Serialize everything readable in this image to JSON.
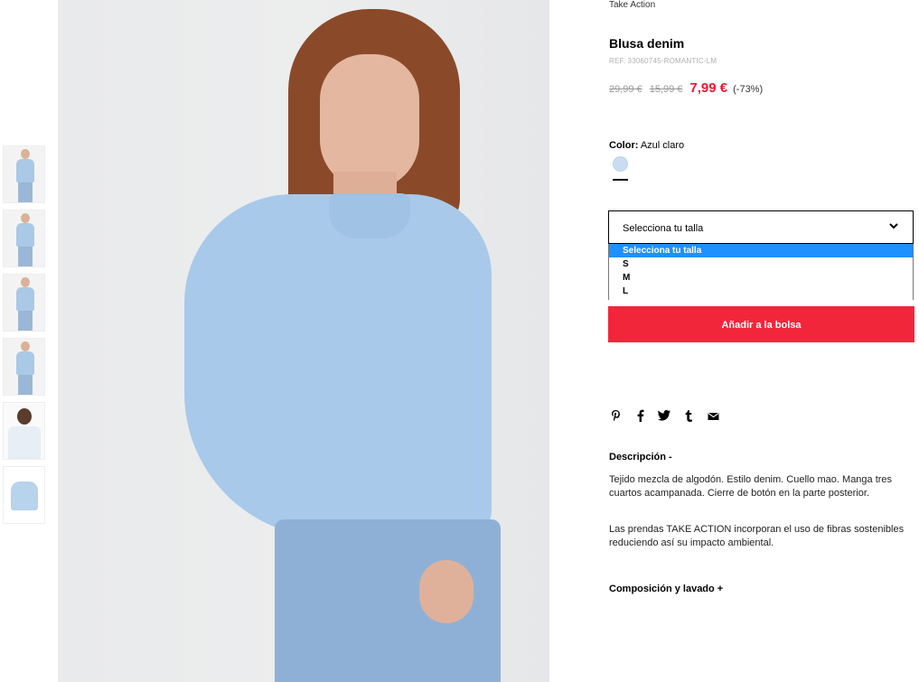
{
  "breadcrumb": "Take Action",
  "product": {
    "title": "Blusa denim",
    "ref": "REF. 33060745-ROMANTIC-LM",
    "price_original": "29,99 €",
    "price_previous": "15,99 €",
    "price_current": "7,99 €",
    "discount": "(-73%)"
  },
  "color": {
    "label": "Color:",
    "value": "Azul claro",
    "swatch_hex": "#c9dcf0"
  },
  "size_select": {
    "selected": "Selecciona tu talla",
    "options": [
      "Selecciona tu talla",
      "S",
      "M",
      "L"
    ]
  },
  "add_to_bag": "Añadir a la bolsa",
  "share_icons": [
    "pinterest-icon",
    "facebook-icon",
    "twitter-icon",
    "tumblr-icon",
    "email-icon"
  ],
  "description": {
    "heading": "Descripción -",
    "paragraph1": "Tejido mezcla de algodón. Estilo denim. Cuello mao. Manga tres cuartos acampanada. Cierre de botón en la parte posterior.",
    "paragraph2": "Las prendas TAKE ACTION incorporan el uso de fibras sostenibles reduciendo así su impacto ambiental."
  },
  "composition_heading": "Composición y lavado +",
  "colors": {
    "price_red": "#e61b2f",
    "button_red": "#f2263a",
    "option_highlight": "#1e90ff"
  }
}
